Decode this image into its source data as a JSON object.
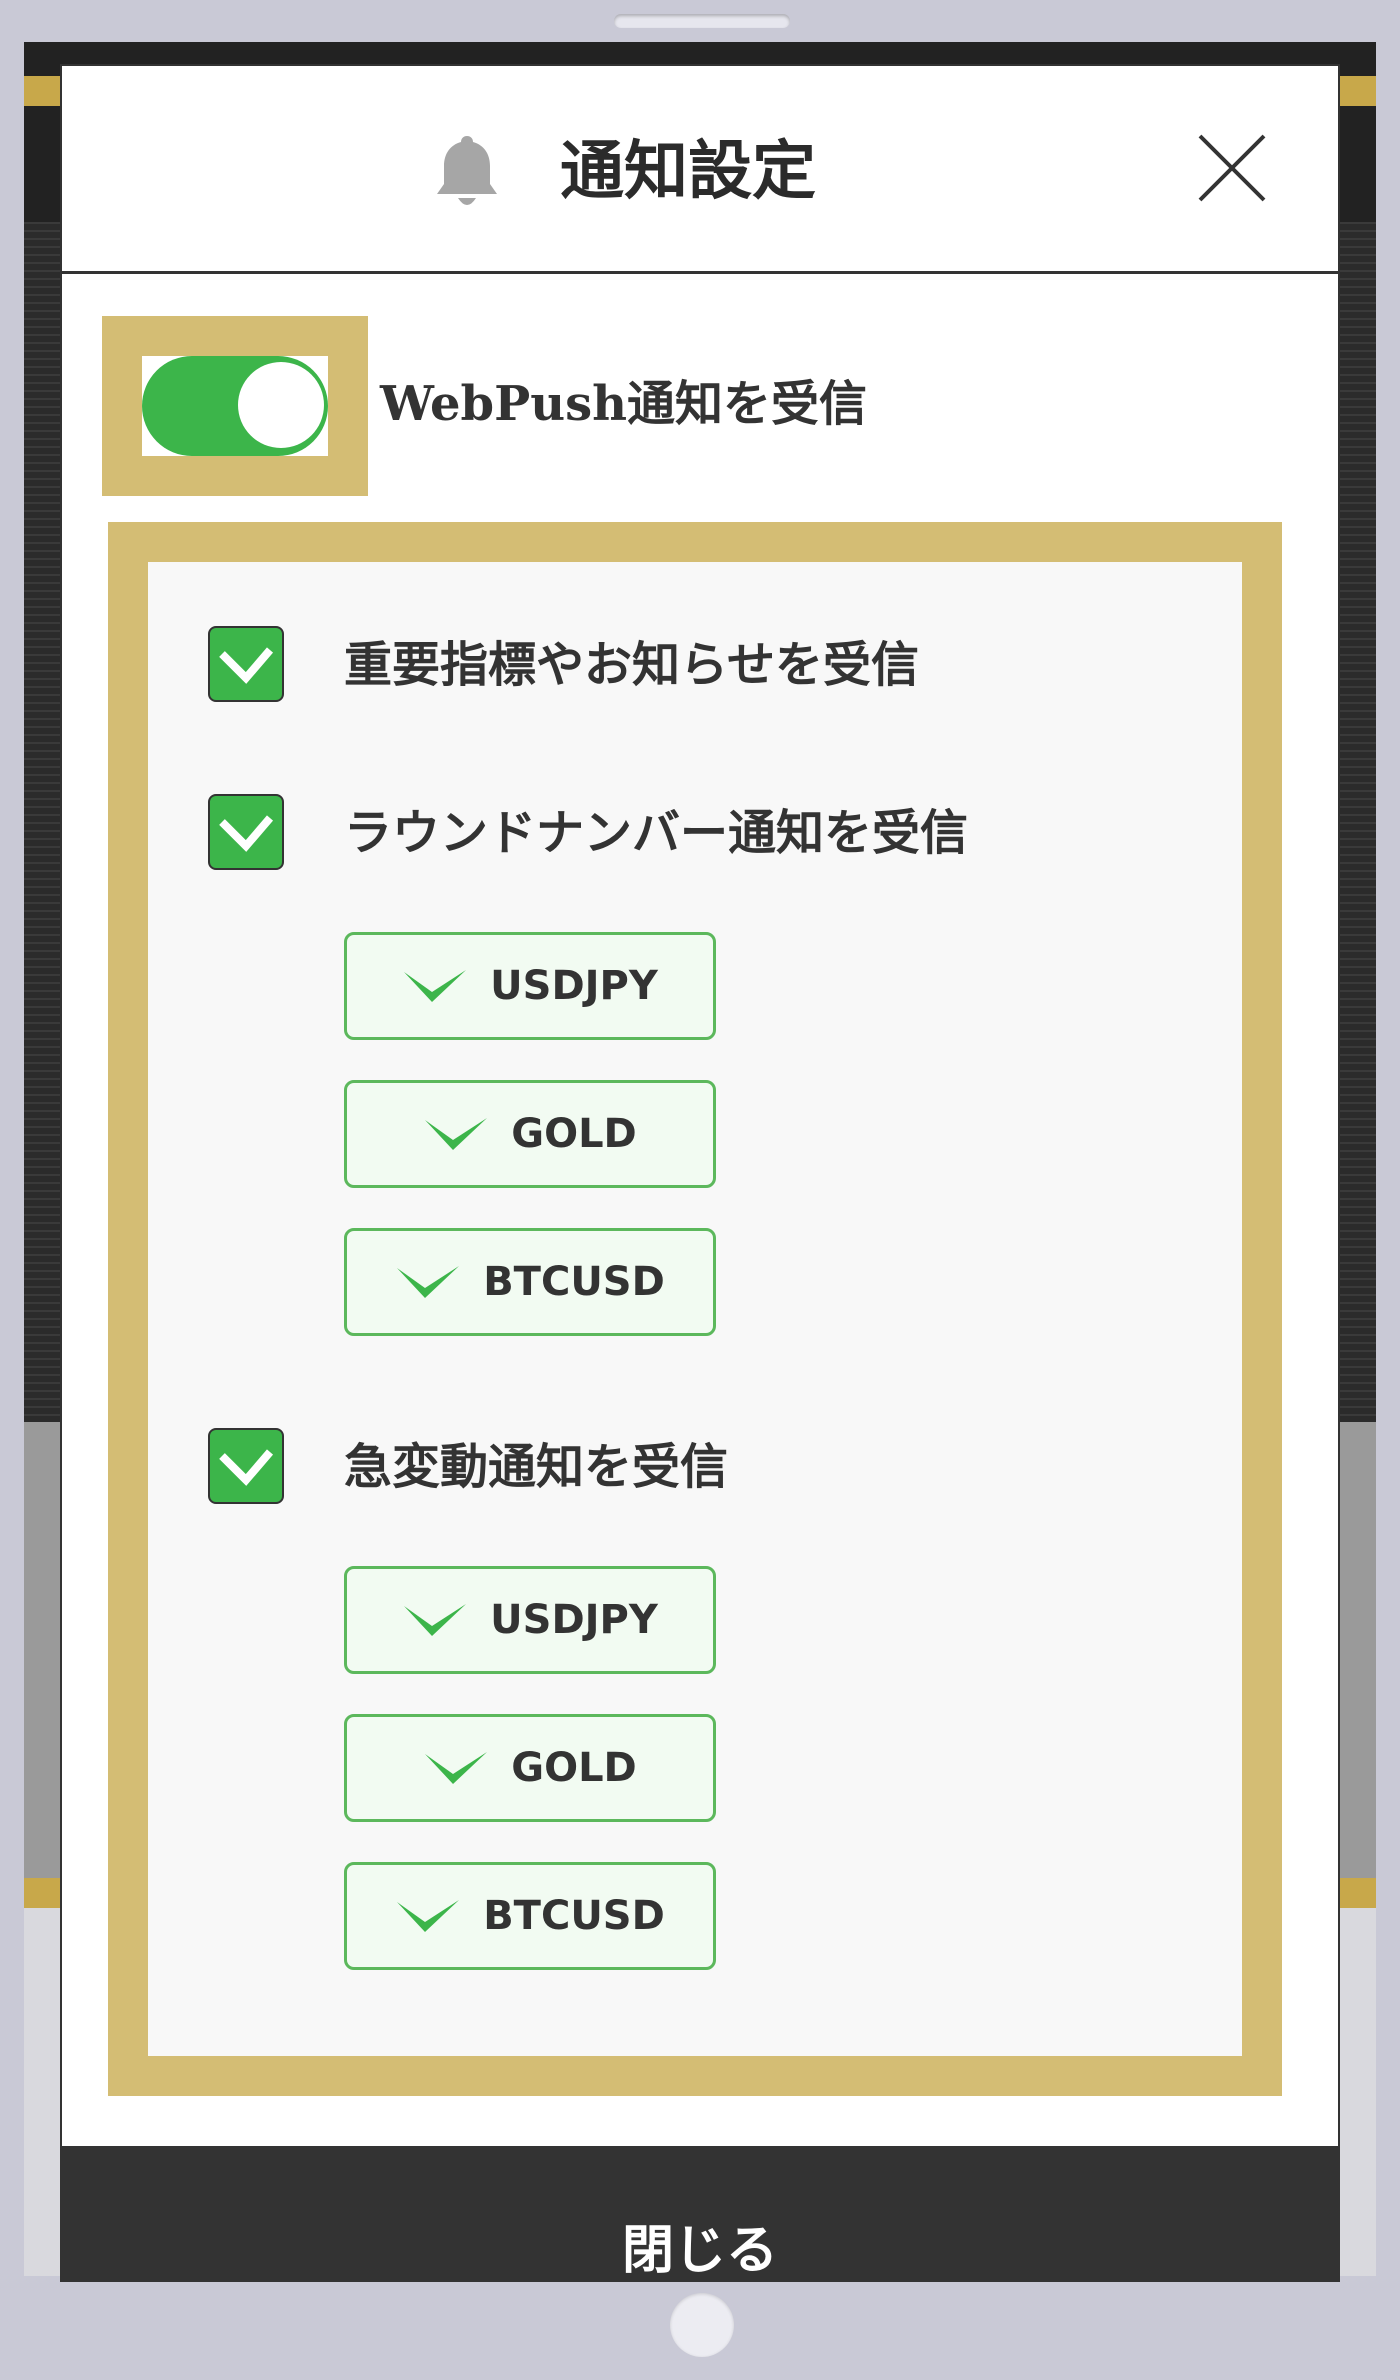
{
  "modal": {
    "title": "通知設定",
    "close_icon": "close-icon",
    "header_icon": "bell-icon"
  },
  "webpush": {
    "label": "WebPush通知を受信",
    "enabled": true
  },
  "settings": {
    "important": {
      "label": "重要指標やお知らせを受信",
      "checked": true
    },
    "round_number": {
      "label": "ラウンドナンバー通知を受信",
      "checked": true,
      "symbols": [
        "USDJPY",
        "GOLD",
        "BTCUSD"
      ]
    },
    "volatility": {
      "label": "急変動通知を受信",
      "checked": true,
      "symbols": [
        "USDJPY",
        "GOLD",
        "BTCUSD"
      ]
    }
  },
  "footer": {
    "close_label": "閉じる"
  },
  "colors": {
    "accent_green": "#3cb54a",
    "gold": "#d4bd74",
    "dark": "#333333"
  }
}
